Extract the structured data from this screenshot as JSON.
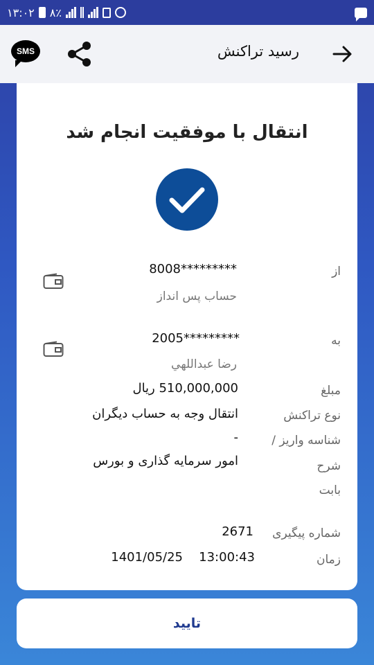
{
  "status_bar": {
    "time": "۱۳:۰۲",
    "battery": "۸٪"
  },
  "app_bar": {
    "title": "رسید تراکنش",
    "sms_label": "SMS"
  },
  "receipt": {
    "success_title": "انتقال با موفقیت انجام شد",
    "from": {
      "label": "از",
      "account": "*********8008",
      "account_name": "حساب پس انداز"
    },
    "to": {
      "label": "به",
      "account": "*********2005",
      "account_name": "رضا عبداللهي"
    },
    "amount": {
      "label": "مبلغ",
      "value": "510,000,000 ریال"
    },
    "type": {
      "label": "نوع تراکنش",
      "value": "انتقال وجه به حساب دیگران"
    },
    "deposit_id": {
      "label": "شناسه واریز /",
      "value": "-"
    },
    "description": {
      "label": "شرح",
      "value": "امور سرمایه گذاری و بورس"
    },
    "reason": {
      "label": "بابت",
      "value": ""
    },
    "tracking": {
      "label": "شماره پیگیری",
      "value": "2671"
    },
    "time": {
      "label": "زمان",
      "date": "1401/05/25",
      "clock": "13:00:43"
    }
  },
  "confirm_button": {
    "label": "تایید"
  },
  "colors": {
    "accent": "#0d4d98",
    "button_text": "#1f3a8f",
    "status_bar": "#2c3d9e"
  }
}
